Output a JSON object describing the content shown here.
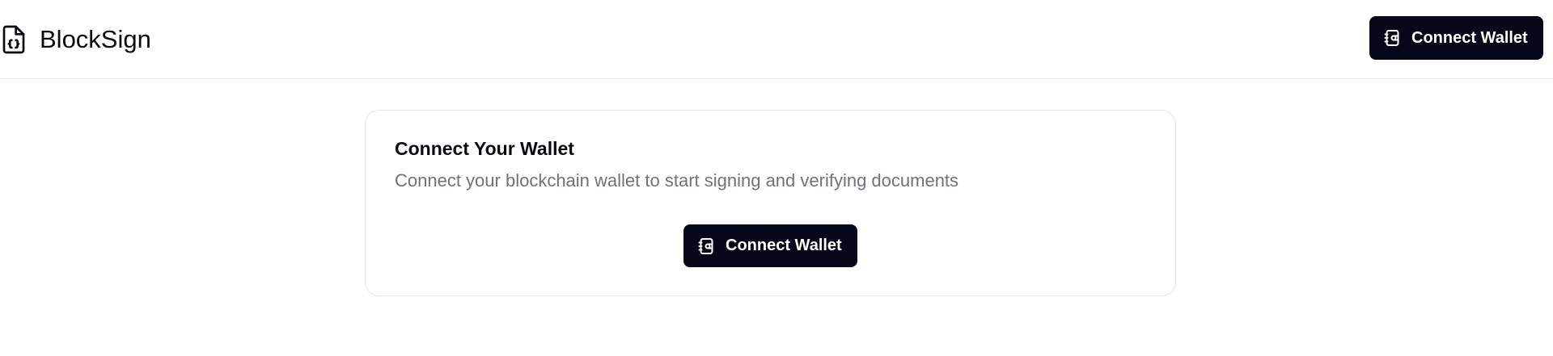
{
  "header": {
    "brand_name": "BlockSign",
    "brand_icon": "file-code-icon",
    "connect_button_label": "Connect Wallet",
    "connect_button_icon": "wallet-icon"
  },
  "card": {
    "title": "Connect Your Wallet",
    "description": "Connect your blockchain wallet to start signing and verifying documents",
    "connect_button_label": "Connect Wallet",
    "connect_button_icon": "wallet-icon"
  },
  "colors": {
    "button_bg": "#07071a",
    "button_text": "#ffffff",
    "muted_text": "#71717a",
    "border": "#e4e4e7"
  }
}
